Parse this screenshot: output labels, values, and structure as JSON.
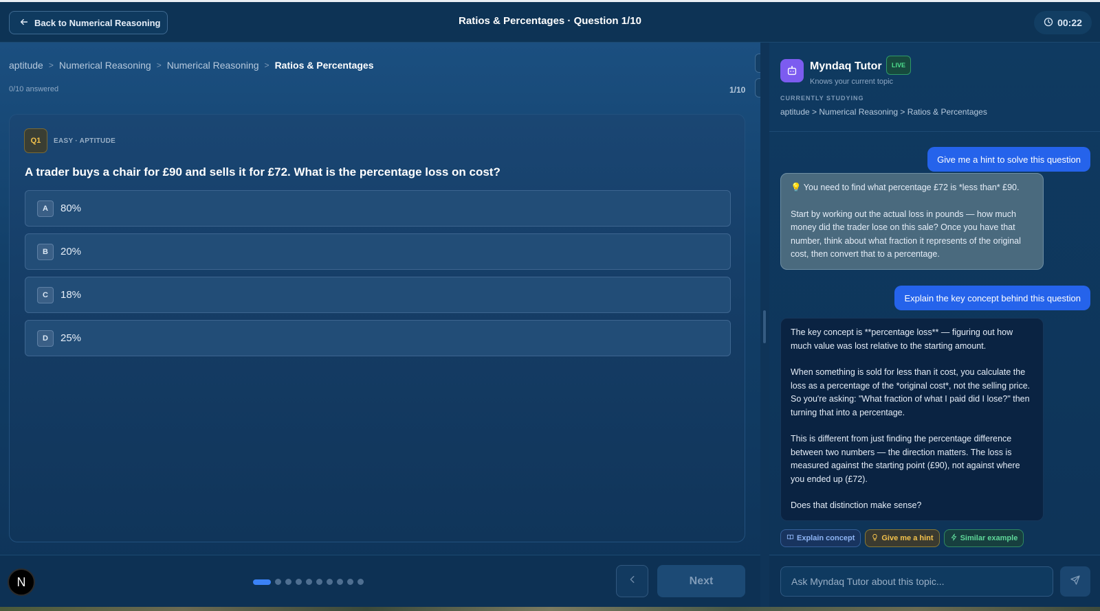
{
  "header": {
    "back_label": "Back to Numerical Reasoning",
    "title": "Ratios & Percentages · Question 1/10",
    "timer": "00:22"
  },
  "breadcrumb": [
    "aptitude",
    "Numerical Reasoning",
    "Numerical Reasoning",
    "Ratios & Percentages"
  ],
  "progress": {
    "answered": "0/10 answered",
    "counter": "1/10",
    "current_index": 1,
    "total": 10
  },
  "question": {
    "badge": "Q1",
    "meta": "EASY · APTITUDE",
    "text": "A trader buys a chair for £90 and sells it for £72. What is the percentage loss on cost?",
    "options": [
      {
        "letter": "A",
        "label": "80%"
      },
      {
        "letter": "B",
        "label": "20%"
      },
      {
        "letter": "C",
        "label": "18%"
      },
      {
        "letter": "D",
        "label": "25%"
      }
    ]
  },
  "footer": {
    "avatar_letter": "N",
    "next_label": "Next"
  },
  "tutor": {
    "name": "Myndaq Tutor",
    "live_badge": "LIVE",
    "subtitle": "Knows your current topic",
    "studying_label": "CURRENTLY STUDYING",
    "studying_path": "aptitude > Numerical Reasoning > Ratios & Percentages",
    "messages": [
      {
        "role": "user",
        "text": "Give me a hint to solve this question"
      },
      {
        "role": "assistant",
        "style": "hint",
        "paragraphs": [
          "💡 You need to find what percentage £72 is *less than* £90.",
          "Start by working out the actual loss in pounds — how much money did the trader lose on this sale? Once you have that number, think about what fraction it represents of the original cost, then convert that to a percentage."
        ]
      },
      {
        "role": "user",
        "text": "Explain the key concept behind this question"
      },
      {
        "role": "assistant",
        "style": "dark",
        "paragraphs": [
          "The key concept is **percentage loss** — figuring out how much value was lost relative to the starting amount.",
          "When something is sold for less than it cost, you calculate the loss as a percentage of the *original cost*, not the selling price. So you're asking: \"What fraction of what I paid did I lose?\" then turning that into a percentage.",
          "This is different from just finding the percentage difference between two numbers — the direction matters. The loss is measured against the starting point (£90), not against where you ended up (£72).",
          "Does that distinction make sense?"
        ]
      }
    ],
    "chips": [
      {
        "label": "Explain concept",
        "icon": "book-icon"
      },
      {
        "label": "Give me a hint",
        "icon": "lightbulb-icon"
      },
      {
        "label": "Similar example",
        "icon": "bolt-icon"
      }
    ],
    "input_placeholder": "Ask Myndaq Tutor about this topic..."
  },
  "colors": {
    "accent": "#2563eb",
    "live": "#4ee08f",
    "badge_gold": "#f3c24c",
    "bot_purple": "#7c5cf0"
  }
}
